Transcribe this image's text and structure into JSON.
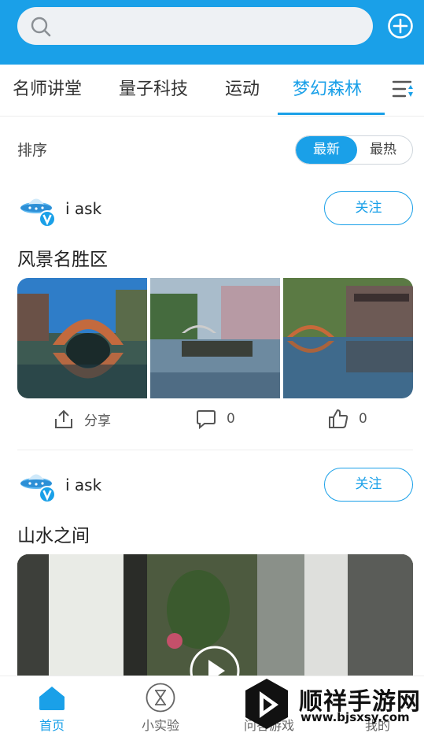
{
  "header": {
    "search_icon": "search-icon",
    "add_icon": "plus-circle-icon",
    "search_placeholder": ""
  },
  "tabs": [
    {
      "label": "名师讲堂",
      "active": false
    },
    {
      "label": "量子科技",
      "active": false
    },
    {
      "label": "运动",
      "active": false
    },
    {
      "label": "梦幻森林",
      "active": true
    }
  ],
  "tab_menu_icon": "sort-menu-icon",
  "sort": {
    "label": "排序",
    "options": [
      "最新",
      "最热"
    ],
    "selected": "最新"
  },
  "posts": [
    {
      "author": "i ask",
      "follow_label": "关注",
      "title": "风景名胜区",
      "media_type": "image-gallery",
      "actions": {
        "share_label": "分享",
        "comment_count": "0",
        "like_count": "0"
      }
    },
    {
      "author": "i ask",
      "follow_label": "关注",
      "title": "山水之间",
      "media_type": "video"
    }
  ],
  "bottom_nav": [
    {
      "label": "首页",
      "icon": "home-icon",
      "active": true
    },
    {
      "label": "小实验",
      "icon": "hourglass-icon",
      "active": false
    },
    {
      "label": "问答游戏",
      "icon": "game-icon",
      "active": false
    },
    {
      "label": "我的",
      "icon": "user-icon",
      "active": false
    }
  ],
  "watermark": {
    "title": "顺祥手游网",
    "url": "www.bjsxsy.com"
  },
  "colors": {
    "accent": "#1aa0e8",
    "header_bg": "#1aa0e8",
    "search_bg": "#eef1f4"
  }
}
